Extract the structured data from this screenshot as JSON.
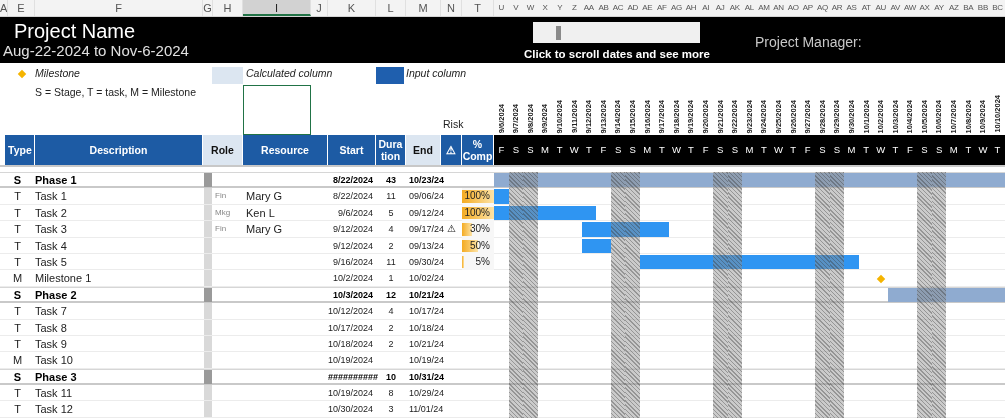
{
  "sheet_columns": [
    {
      "label": "A",
      "selected": false
    },
    {
      "label": "E",
      "selected": false
    },
    {
      "label": "F",
      "selected": false
    },
    {
      "label": "G",
      "selected": false
    },
    {
      "label": "H",
      "selected": false
    },
    {
      "label": "I",
      "selected": true
    },
    {
      "label": "J",
      "selected": false
    },
    {
      "label": "K",
      "selected": false
    },
    {
      "label": "L",
      "selected": false
    },
    {
      "label": "M",
      "selected": false
    },
    {
      "label": "N",
      "selected": false
    },
    {
      "label": "T",
      "selected": false
    },
    {
      "label": "U",
      "selected": false
    },
    {
      "label": "V",
      "selected": false
    },
    {
      "label": "W",
      "selected": false
    },
    {
      "label": "X",
      "selected": false
    },
    {
      "label": "Y",
      "selected": false
    },
    {
      "label": "Z",
      "selected": false
    },
    {
      "label": "AA",
      "selected": false
    },
    {
      "label": "AB",
      "selected": false
    },
    {
      "label": "AC",
      "selected": false
    },
    {
      "label": "AD",
      "selected": false
    },
    {
      "label": "AE",
      "selected": false
    },
    {
      "label": "AF",
      "selected": false
    },
    {
      "label": "AG",
      "selected": false
    },
    {
      "label": "AH",
      "selected": false
    },
    {
      "label": "AI",
      "selected": false
    },
    {
      "label": "AJ",
      "selected": false
    },
    {
      "label": "AK",
      "selected": false
    },
    {
      "label": "AL",
      "selected": false
    },
    {
      "label": "AM",
      "selected": false
    },
    {
      "label": "AN",
      "selected": false
    },
    {
      "label": "AO",
      "selected": false
    },
    {
      "label": "AP",
      "selected": false
    },
    {
      "label": "AQ",
      "selected": false
    },
    {
      "label": "AR",
      "selected": false
    },
    {
      "label": "AS",
      "selected": false
    },
    {
      "label": "AT",
      "selected": false
    },
    {
      "label": "AU",
      "selected": false
    },
    {
      "label": "AV",
      "selected": false
    },
    {
      "label": "AW",
      "selected": false
    },
    {
      "label": "AX",
      "selected": false
    },
    {
      "label": "AY",
      "selected": false
    },
    {
      "label": "AZ",
      "selected": false
    },
    {
      "label": "BA",
      "selected": false
    },
    {
      "label": "BB",
      "selected": false
    },
    {
      "label": "BC",
      "selected": false
    }
  ],
  "title": "Project Name",
  "date_range": "Aug-22-2024 to Nov-6-2024",
  "scroll_hint": "Click to scroll dates and see more",
  "project_manager_label": "Project Manager:",
  "legend": {
    "milestone": "Milestone",
    "type_key": "S = Stage, T = task, M = Milestone",
    "calculated": "Calculated column",
    "input": "Input column"
  },
  "risk_label": "Risk",
  "columns": [
    {
      "label": "Type",
      "kind": "input"
    },
    {
      "label": "Description",
      "kind": "input"
    },
    {
      "label": "Role",
      "kind": "calculated"
    },
    {
      "label": "Resource",
      "kind": "input"
    },
    {
      "label": "Start",
      "kind": "input"
    },
    {
      "label": "Duration",
      "kind": "input"
    },
    {
      "label": "End",
      "kind": "calculated"
    },
    {
      "label": "⚠",
      "kind": "input"
    },
    {
      "label": "% Comp",
      "kind": "input"
    }
  ],
  "days": [
    {
      "date": "9/6/2024",
      "weekday": "F"
    },
    {
      "date": "9/7/2024",
      "weekday": "S"
    },
    {
      "date": "9/8/2024",
      "weekday": "S"
    },
    {
      "date": "9/9/2024",
      "weekday": "M"
    },
    {
      "date": "9/10/2024",
      "weekday": "T"
    },
    {
      "date": "9/11/2024",
      "weekday": "W"
    },
    {
      "date": "9/12/2024",
      "weekday": "T"
    },
    {
      "date": "9/13/2024",
      "weekday": "F"
    },
    {
      "date": "9/14/2024",
      "weekday": "S"
    },
    {
      "date": "9/15/2024",
      "weekday": "S"
    },
    {
      "date": "9/16/2024",
      "weekday": "M"
    },
    {
      "date": "9/17/2024",
      "weekday": "T"
    },
    {
      "date": "9/18/2024",
      "weekday": "W"
    },
    {
      "date": "9/19/2024",
      "weekday": "T"
    },
    {
      "date": "9/20/2024",
      "weekday": "F"
    },
    {
      "date": "9/21/2024",
      "weekday": "S"
    },
    {
      "date": "9/22/2024",
      "weekday": "S"
    },
    {
      "date": "9/23/2024",
      "weekday": "M"
    },
    {
      "date": "9/24/2024",
      "weekday": "T"
    },
    {
      "date": "9/25/2024",
      "weekday": "W"
    },
    {
      "date": "9/26/2024",
      "weekday": "T"
    },
    {
      "date": "9/27/2024",
      "weekday": "F"
    },
    {
      "date": "9/28/2024",
      "weekday": "S"
    },
    {
      "date": "9/29/2024",
      "weekday": "S"
    },
    {
      "date": "9/30/2024",
      "weekday": "M"
    },
    {
      "date": "10/1/2024",
      "weekday": "T"
    },
    {
      "date": "10/2/2024",
      "weekday": "W"
    },
    {
      "date": "10/3/2024",
      "weekday": "T"
    },
    {
      "date": "10/4/2024",
      "weekday": "F"
    },
    {
      "date": "10/5/2024",
      "weekday": "S"
    },
    {
      "date": "10/6/2024",
      "weekday": "S"
    },
    {
      "date": "10/7/2024",
      "weekday": "M"
    },
    {
      "date": "10/8/2024",
      "weekday": "T"
    },
    {
      "date": "10/9/2024",
      "weekday": "W"
    },
    {
      "date": "10/10/2024",
      "weekday": "T"
    }
  ],
  "rows": [
    {
      "kind": "stage",
      "type": "S",
      "description": "Phase 1",
      "start": "8/22/2024",
      "duration": "43",
      "end": "10/23/24"
    },
    {
      "kind": "task",
      "type": "T",
      "description": "Task 1",
      "role": "Fin",
      "resource": "Mary G",
      "start": "8/22/2024",
      "duration": "11",
      "end": "09/06/24",
      "complete": "100%",
      "level": 1
    },
    {
      "kind": "task",
      "type": "T",
      "description": "Task 2",
      "role": "Mkg",
      "resource": "Ken L",
      "start": "9/6/2024",
      "duration": "5",
      "end": "09/12/24",
      "complete": "100%",
      "level": 1
    },
    {
      "kind": "task",
      "type": "T",
      "description": "Task 3",
      "role": "Fin",
      "resource": "Mary G",
      "start": "9/12/2024",
      "duration": "4",
      "end": "09/17/24",
      "risk": "⚠",
      "complete": "30%",
      "level": 0.3
    },
    {
      "kind": "task",
      "type": "T",
      "description": "Task 4",
      "start": "9/12/2024",
      "duration": "2",
      "end": "09/13/24",
      "complete": "50%",
      "level": 0.5
    },
    {
      "kind": "task",
      "type": "T",
      "description": "Task 5",
      "start": "9/16/2024",
      "duration": "11",
      "end": "09/30/24",
      "complete": "5%",
      "level": 0.05
    },
    {
      "kind": "milestone",
      "type": "M",
      "description": "Milestone 1",
      "start": "10/2/2024",
      "duration": "1",
      "end": "10/02/24"
    },
    {
      "kind": "stage",
      "type": "S",
      "description": "Phase 2",
      "start": "10/3/2024",
      "duration": "12",
      "end": "10/21/24"
    },
    {
      "kind": "task",
      "type": "T",
      "description": "Task 7",
      "start": "10/12/2024",
      "duration": "4",
      "end": "10/17/24"
    },
    {
      "kind": "task",
      "type": "T",
      "description": "Task 8",
      "start": "10/17/2024",
      "duration": "2",
      "end": "10/18/24"
    },
    {
      "kind": "task",
      "type": "T",
      "description": "Task 9",
      "start": "10/18/2024",
      "duration": "2",
      "end": "10/21/24"
    },
    {
      "kind": "milestone",
      "type": "M",
      "description": "Task 10",
      "start": "10/19/2024",
      "end": "10/19/24"
    },
    {
      "kind": "stage",
      "type": "S",
      "description": "Phase 3",
      "start": "##########",
      "duration": "10",
      "end": "10/31/24"
    },
    {
      "kind": "task",
      "type": "T",
      "description": "Task 11",
      "start": "10/19/2024",
      "duration": "8",
      "end": "10/29/24"
    },
    {
      "kind": "task",
      "type": "T",
      "description": "Task 12",
      "start": "10/30/2024",
      "duration": "3",
      "end": "11/01/24"
    }
  ]
}
